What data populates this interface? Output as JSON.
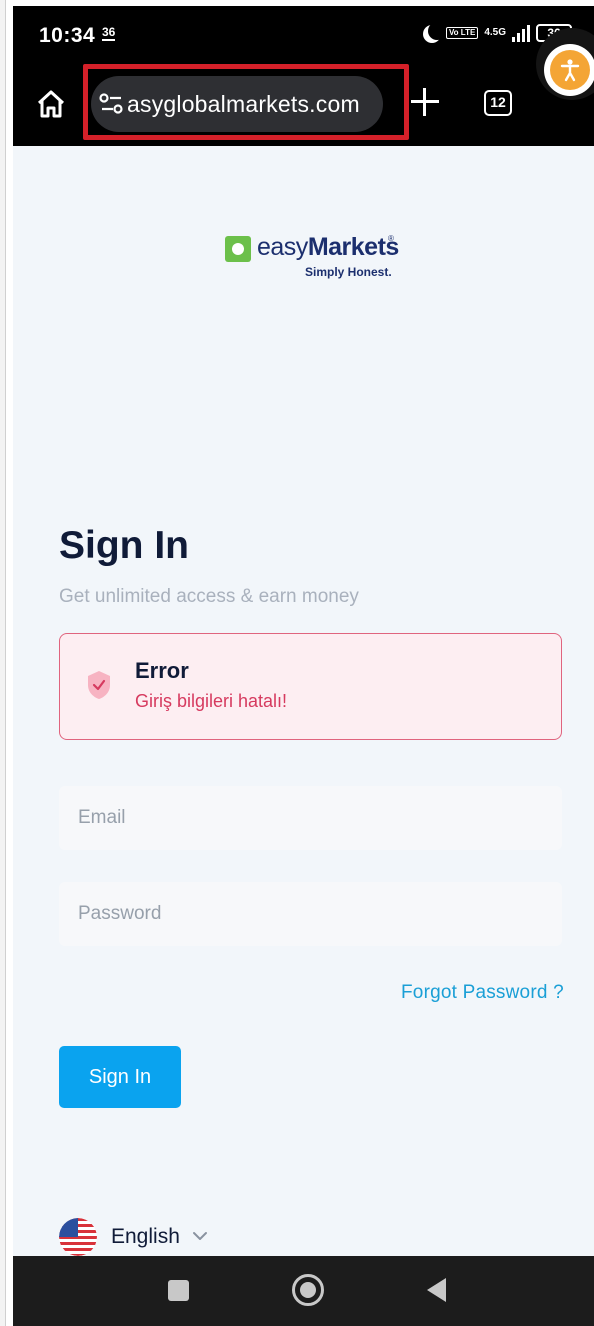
{
  "status_bar": {
    "time": "10:34",
    "small_indicator": "36",
    "volte": "Vo LTE",
    "network": "4.5G",
    "battery": "36"
  },
  "browser": {
    "url": "asyglobalmarkets.com",
    "tab_count": "12",
    "highlight_color": "#d42029"
  },
  "logo": {
    "word_light": "easy",
    "word_bold": "Markets",
    "registered": "®",
    "tagline": "Simply Honest."
  },
  "signin": {
    "title": "Sign In",
    "subtitle": "Get unlimited access & earn money",
    "error_title": "Error",
    "error_message": "Giriş bilgileri hatalı!",
    "email_placeholder": "Email",
    "password_placeholder": "Password",
    "forgot_label": "Forgot Password ?",
    "button_label": "Sign In"
  },
  "language": {
    "selected": "English"
  },
  "colors": {
    "accent": "#0aa3ef",
    "error_border": "#e0647e",
    "error_text": "#d63a5f",
    "link": "#1a9fd6",
    "brand_green": "#6cc04a",
    "brand_navy": "#1c2f6e"
  }
}
